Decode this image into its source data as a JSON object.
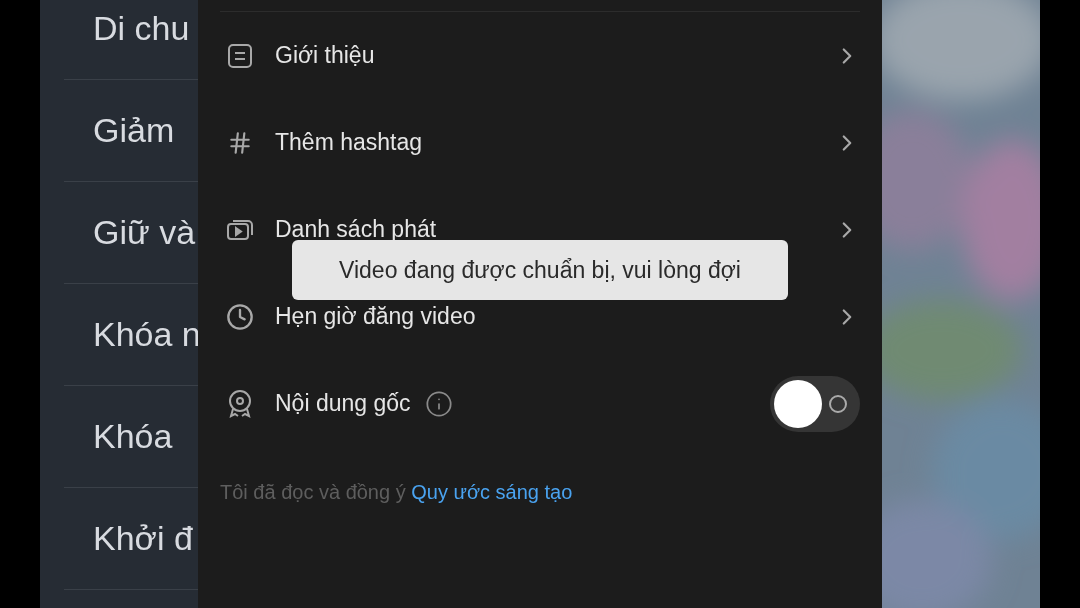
{
  "background_list": [
    {
      "label": "Di chu"
    },
    {
      "label": "Giảm"
    },
    {
      "label": "Giữ và"
    },
    {
      "label": "Khóa n"
    },
    {
      "label": "Khóa"
    },
    {
      "label": "Khởi đ"
    }
  ],
  "settings": [
    {
      "kind": "link",
      "label": "Giới thiệu"
    },
    {
      "kind": "link",
      "label": "Thêm hashtag"
    },
    {
      "kind": "link",
      "label": "Danh sách phát"
    },
    {
      "kind": "link",
      "label": "Hẹn giờ đăng video"
    },
    {
      "kind": "toggle",
      "label": "Nội dung gốc",
      "on": false
    }
  ],
  "agreement": {
    "text": "Tôi đã đọc và đồng ý",
    "link": "Quy ước sáng tạo"
  },
  "toast": "Video đang được chuẩn bị, vui lòng đợi"
}
